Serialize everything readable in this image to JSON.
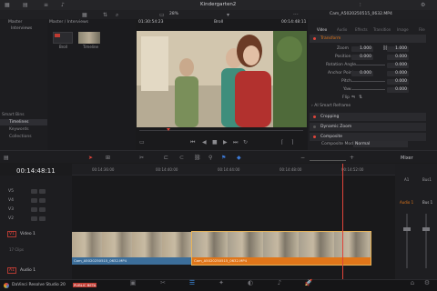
{
  "app": {
    "project_title": "Kindergarten2",
    "brand": "DaVinci Resolve Studio 20",
    "beta_badge": "PUBLIC BETA"
  },
  "media_pool": {
    "bin_master": "Master",
    "bin_interviews": "Interviews",
    "path": "Master / Interviews",
    "clips": [
      {
        "label": "Broll"
      },
      {
        "label": "Timeline"
      }
    ],
    "smart_bins_label": "Smart Bins",
    "smart_items": [
      "Timelines",
      "Keywords",
      "Collections"
    ]
  },
  "viewer": {
    "zoom": "28%",
    "timecode_left": "01:30:54:23",
    "clip_name": "Broll",
    "timecode_right": "00:14:48:11"
  },
  "inspector": {
    "filename": "Cam_A5020250515_0632.MP4",
    "tabs": [
      "Video",
      "Audio",
      "Effects",
      "Transition",
      "Image",
      "File"
    ],
    "transform_label": "Transform",
    "params": [
      {
        "label": "Zoom",
        "x": "1.000",
        "y": "1.000"
      },
      {
        "label": "Position",
        "x": "0.000",
        "y": "0.000"
      },
      {
        "label": "Rotation Angle",
        "x": "",
        "y": "0.000"
      },
      {
        "label": "Anchor Point",
        "x": "0.000",
        "y": "0.000"
      },
      {
        "label": "Pitch",
        "x": "",
        "y": "0.000"
      },
      {
        "label": "Yaw",
        "x": "",
        "y": "0.000"
      },
      {
        "label": "Flip",
        "x": "",
        "y": ""
      }
    ],
    "ai_smart_reframe": "AI Smart Reframe",
    "cropping": "Cropping",
    "dynamic_zoom": "Dynamic Zoom",
    "composite": "Composite",
    "composite_mode_label": "Composite Mode",
    "composite_mode_value": "Normal"
  },
  "timeline": {
    "timecode": "00:14:48:11",
    "ruler": [
      "00:14:36:00",
      "00:14:40:00",
      "00:14:44:00",
      "00:14:48:00",
      "00:14:52:00"
    ],
    "tracks": [
      "V5",
      "V4",
      "V3",
      "V2"
    ],
    "v1_label": "V1",
    "v1_name": "Video 1",
    "v1_clips_count": "17 Clips",
    "a1_label": "A1",
    "a1_name": "Audio 1",
    "clip_blue": "Cam_A5020250515_0632.MP4",
    "clip_orange": "Cam_A5020250515_0632.MP4"
  },
  "mixer": {
    "title": "Mixer",
    "ch1": "A1",
    "bus": "Bus1",
    "ch1_name": "Audio 1",
    "bus_name": "Bus 1"
  },
  "colors": {
    "accent_orange": "#e0761a",
    "clip_blue": "#3c6e9a",
    "playhead": "#e0443a"
  }
}
